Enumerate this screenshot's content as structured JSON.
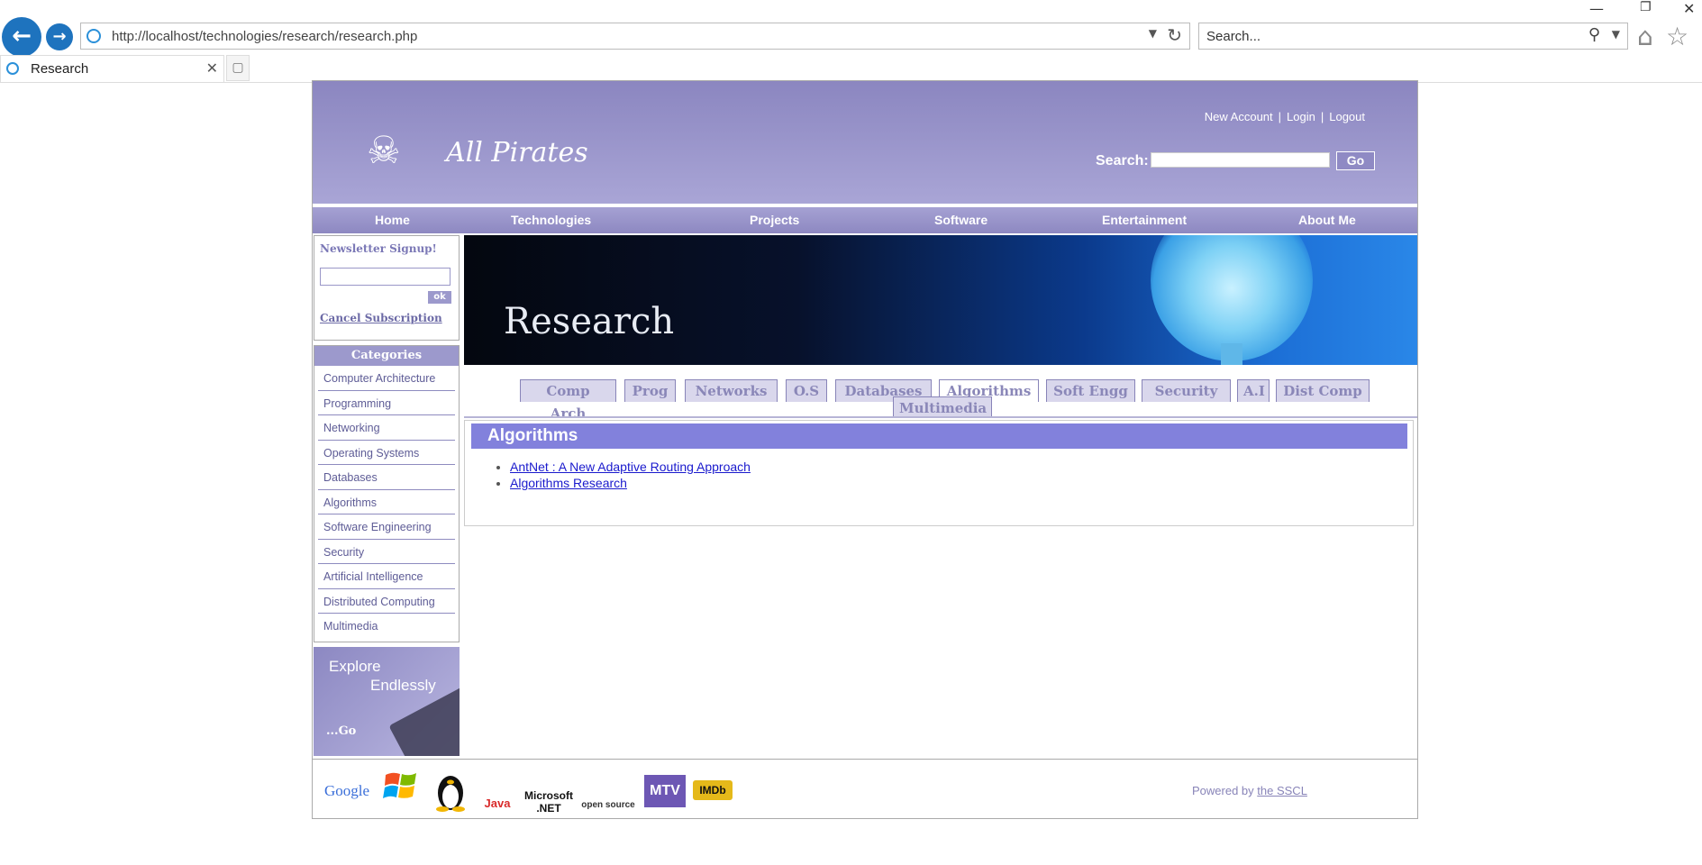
{
  "browser": {
    "url": "http://localhost/technologies/research/research.php",
    "search_placeholder": "Search...",
    "tab_title": "Research"
  },
  "header": {
    "logo_text": "All Pirates",
    "links": [
      "New Account",
      "Login",
      "Logout"
    ],
    "search_label": "Search:",
    "go_label": "Go"
  },
  "nav": [
    "Home",
    "Technologies",
    "Projects",
    "Software",
    "Entertainment",
    "About Me"
  ],
  "newsletter": {
    "title": "Newsletter Signup!",
    "ok_label": "ok",
    "cancel_label": "Cancel Subscription"
  },
  "categories": {
    "title": "Categories",
    "items": [
      "Computer Architecture",
      "Programming",
      "Networking",
      "Operating Systems",
      "Databases",
      "Algorithms",
      "Software Engineering",
      "Security",
      "Artificial Intelligence",
      "Distributed Computing",
      "Multimedia"
    ]
  },
  "explore": {
    "line1": "Explore",
    "line2": "Endlessly",
    "go": "...Go"
  },
  "banner_title": "Research",
  "subtabs": [
    "Comp Arch",
    "Prog",
    "Networks",
    "O.S",
    "Databases",
    "Algorithms",
    "Soft Engg",
    "Security",
    "A.I",
    "Dist Comp",
    "Multimedia"
  ],
  "active_subtab": "Algorithms",
  "content": {
    "heading": "Algorithms",
    "links": [
      "AntNet : A New Adaptive Routing Approach",
      "Algorithms Research"
    ]
  },
  "footer": {
    "logos": [
      "Google",
      "Windows",
      "Linux",
      "Java",
      "Microsoft .NET",
      "open source",
      "MTV",
      "IMDb"
    ],
    "powered_prefix": "Powered by",
    "powered_link": "the SSCL"
  }
}
